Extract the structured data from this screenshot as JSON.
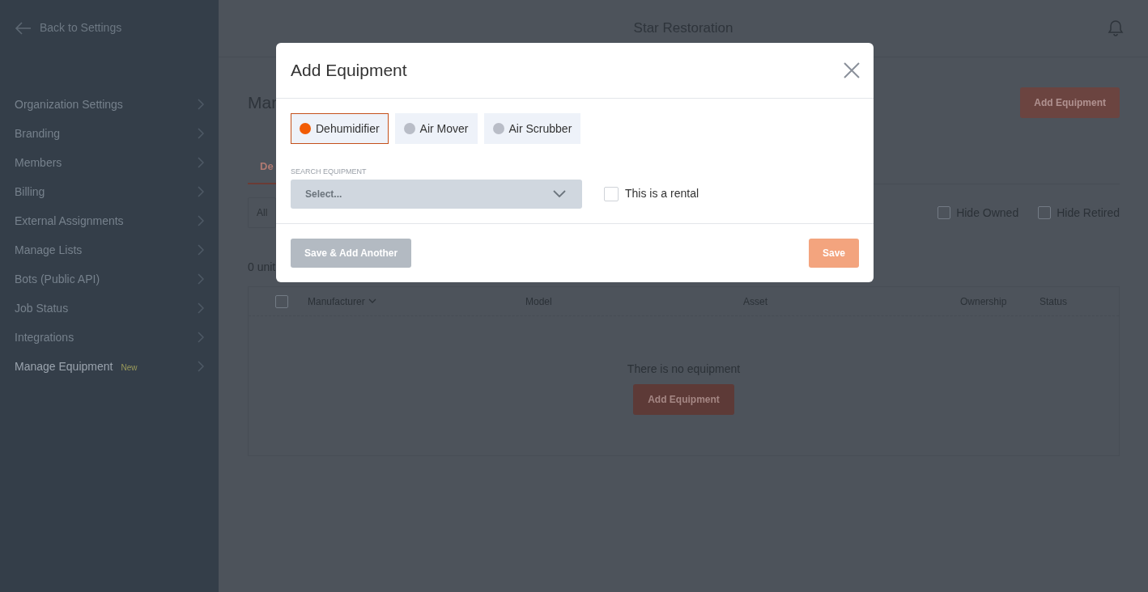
{
  "app_header": {
    "title": "Star Restoration"
  },
  "sidebar": {
    "back_link": "Back to Settings",
    "items": [
      {
        "label": "Organization Settings",
        "selected": false
      },
      {
        "label": "Branding",
        "selected": false
      },
      {
        "label": "Members",
        "selected": false
      },
      {
        "label": "Billing",
        "selected": false
      },
      {
        "label": "External Assignments",
        "selected": false
      },
      {
        "label": "Manage Lists",
        "selected": false
      },
      {
        "label": "Bots (Public API)",
        "selected": false
      },
      {
        "label": "Job Status",
        "selected": false
      },
      {
        "label": "Integrations",
        "selected": false
      },
      {
        "label": "Manage Equipment",
        "badge": "New",
        "selected": true
      }
    ]
  },
  "page": {
    "heading": "Mar",
    "add_button": "Add Equipment",
    "tabs": [
      {
        "label": "De",
        "selected": true
      }
    ],
    "filter": "All",
    "toggles": [
      {
        "label": "Hide Owned",
        "checked": false
      },
      {
        "label": "Hide Retired",
        "checked": false
      }
    ],
    "count": "0 unit",
    "table": {
      "select_all_checked": false,
      "columns": [
        {
          "label": "Manufacturer",
          "sorted": true
        },
        {
          "label": "Model",
          "sorted": false
        },
        {
          "label": "Asset",
          "sorted": false
        },
        {
          "label": "Ownership",
          "sorted": false
        },
        {
          "label": "Status",
          "sorted": false
        }
      ],
      "empty_text": "There is no equipment",
      "empty_button": "Add Equipment"
    }
  },
  "modal": {
    "title": "Add Equipment",
    "types": [
      {
        "label": "Dehumidifier",
        "selected": true
      },
      {
        "label": "Air Mover",
        "selected": false
      },
      {
        "label": "Air Scrubber",
        "selected": false
      }
    ],
    "search": {
      "label": "SEARCH EQUIPMENT",
      "placeholder": "Select..."
    },
    "rental": {
      "label": "This is a rental",
      "checked": false
    },
    "buttons": [
      {
        "label": "Save & Add Another",
        "kind": "secondary",
        "disabled": true
      },
      {
        "label": "Save",
        "kind": "primary",
        "disabled": true
      }
    ]
  }
}
